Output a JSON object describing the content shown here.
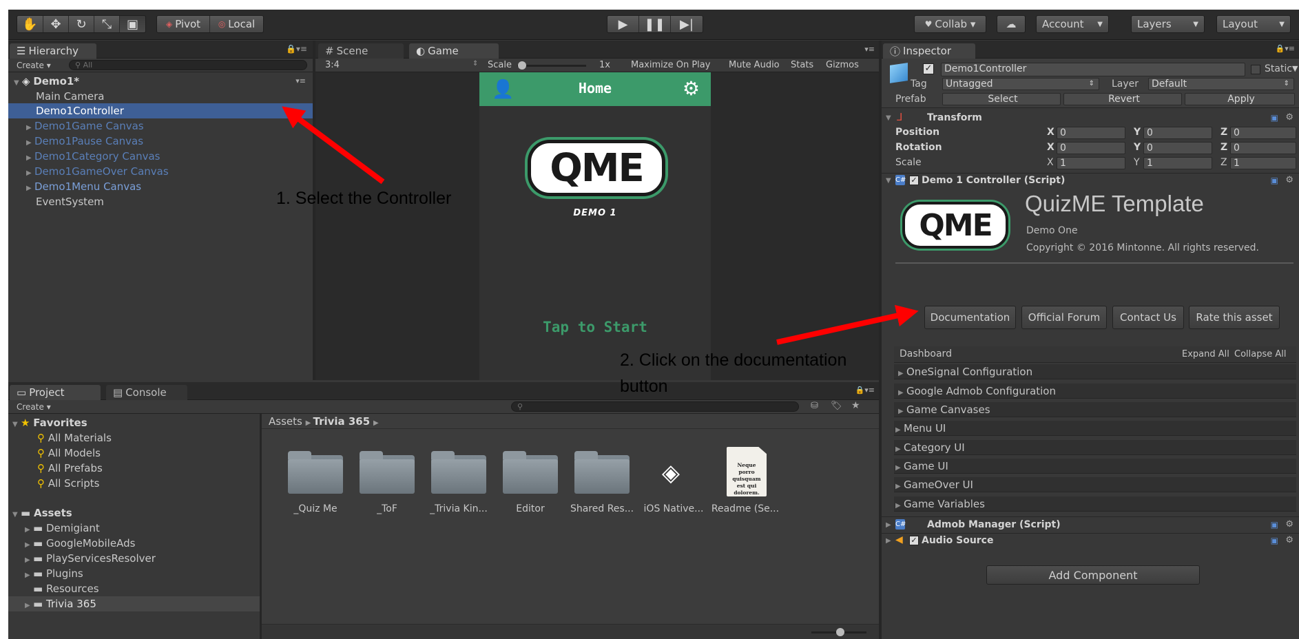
{
  "toolbar": {
    "pivot_label": "Pivot",
    "local_label": "Local",
    "collab_label": "Collab ▾",
    "account_label": "Account",
    "layers_label": "Layers",
    "layout_label": "Layout"
  },
  "hierarchy": {
    "tab_label": "Hierarchy",
    "create_label": "Create ▾",
    "search_placeholder": "All",
    "scene_name": "Demo1*",
    "items": [
      {
        "label": "Main Camera"
      },
      {
        "label": "Demo1Controller"
      },
      {
        "label": "Demo1Game Canvas"
      },
      {
        "label": "Demo1Pause Canvas"
      },
      {
        "label": "Demo1Category Canvas"
      },
      {
        "label": "Demo1GameOver Canvas"
      },
      {
        "label": "Demo1Menu Canvas"
      },
      {
        "label": "EventSystem"
      }
    ]
  },
  "scene_view": {
    "scene_tab": "Scene",
    "game_tab": "Game",
    "aspect": "3:4",
    "scale_label": "Scale",
    "scale_value": "1x",
    "maximize_label": "Maximize On Play",
    "mute_label": "Mute Audio",
    "stats_label": "Stats",
    "gizmos_label": "Gizmos",
    "game": {
      "header_title": "Home",
      "logo_text": "QME",
      "subtitle": "DEMO 1",
      "tap_text": "Tap to Start"
    }
  },
  "project": {
    "project_tab": "Project",
    "console_tab": "Console",
    "create_label": "Create ▾",
    "favorites_label": "Favorites",
    "favorites": [
      {
        "label": "All Materials"
      },
      {
        "label": "All Models"
      },
      {
        "label": "All Prefabs"
      },
      {
        "label": "All Scripts"
      }
    ],
    "assets_label": "Assets",
    "assets_tree": [
      {
        "label": "Demigiant"
      },
      {
        "label": "GoogleMobileAds"
      },
      {
        "label": "PlayServicesResolver"
      },
      {
        "label": "Plugins"
      },
      {
        "label": "Resources"
      },
      {
        "label": "Trivia 365"
      }
    ],
    "breadcrumb_root": "Assets",
    "breadcrumb_current": "Trivia 365",
    "grid": [
      {
        "label": "_Quiz Me"
      },
      {
        "label": "_ToF"
      },
      {
        "label": "_Trivia Kin..."
      },
      {
        "label": "Editor"
      },
      {
        "label": "Shared Res..."
      },
      {
        "label": "iOS Native..."
      },
      {
        "label": "Readme (Se..."
      }
    ],
    "readme_text": "Neque porro quisquam est qui dolorem."
  },
  "inspector": {
    "tab_label": "Inspector",
    "object_name": "Demo1Controller",
    "static_label": "Static",
    "tag_label": "Tag",
    "tag_value": "Untagged",
    "layer_label": "Layer",
    "layer_value": "Default",
    "prefab_label": "Prefab",
    "select_label": "Select",
    "revert_label": "Revert",
    "apply_label": "Apply",
    "transform_label": "Transform",
    "position_label": "Position",
    "rotation_label": "Rotation",
    "scale_label": "Scale",
    "position": {
      "x": "0",
      "y": "0",
      "z": "0"
    },
    "rotation": {
      "x": "0",
      "y": "0",
      "z": "0"
    },
    "scale": {
      "x": "1",
      "y": "1",
      "z": "1"
    },
    "script_label": "Demo 1 Controller (Script)",
    "template_title": "QuizME Template",
    "template_subtitle": "Demo One",
    "copyright": "Copyright © 2016 Mintonne. All rights reserved.",
    "btn_documentation": "Documentation",
    "btn_forum": "Official Forum",
    "btn_contact": "Contact Us",
    "btn_rate": "Rate this asset",
    "dashboard_label": "Dashboard",
    "expand_all": "Expand All",
    "collapse_all": "Collapse All",
    "sections": [
      {
        "label": "OneSignal Configuration"
      },
      {
        "label": "Google Admob Configuration"
      },
      {
        "label": "Game Canvases"
      },
      {
        "label": "Menu UI"
      },
      {
        "label": "Category UI"
      },
      {
        "label": "Game UI"
      },
      {
        "label": "GameOver UI"
      },
      {
        "label": "Game Variables"
      }
    ],
    "admob_label": "Admob Manager (Script)",
    "audio_label": "Audio Source",
    "add_component": "Add Component"
  },
  "annotations": {
    "step1": "1.  Select the Controller",
    "step2_line1": "2. Click on the documentation",
    "step2_line2": "button"
  },
  "colors": {
    "selection": "#3e5f96",
    "prefab_blue": "#5a7fb8",
    "game_header": "#3c9a6a",
    "game_bg": "#323232",
    "arrow": "#ff0000"
  }
}
